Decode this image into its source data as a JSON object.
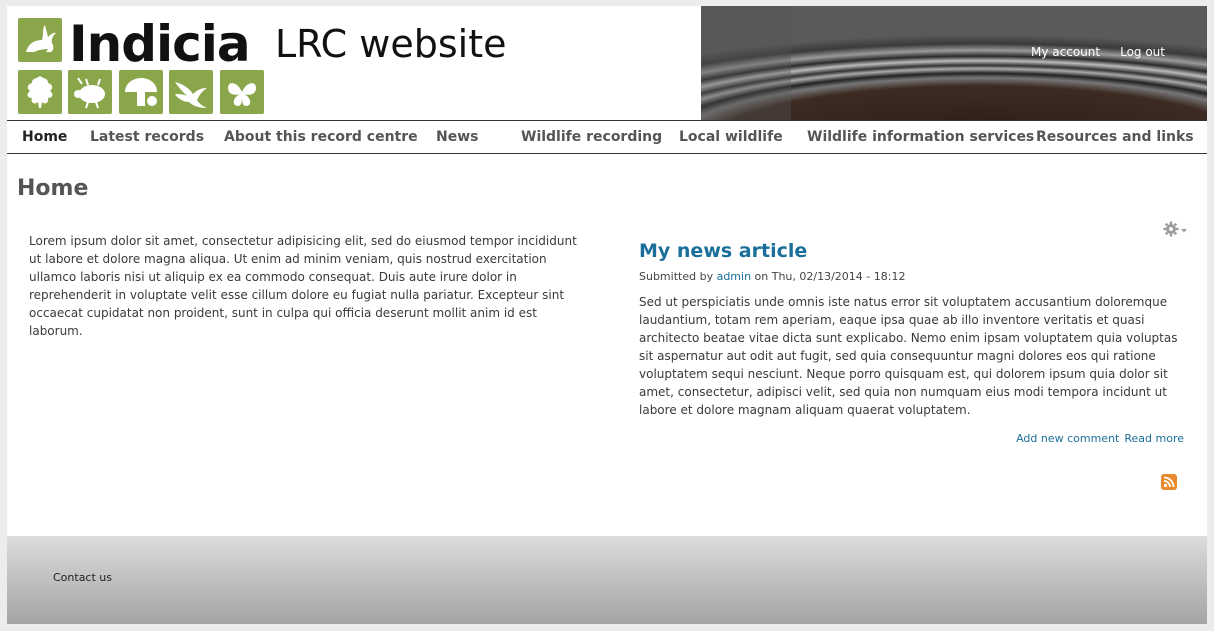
{
  "header": {
    "brand": "Indicia",
    "site_subtitle": "LRC website",
    "user_links": [
      "My account",
      "Log out"
    ]
  },
  "nav": {
    "items": [
      "Home",
      "Latest records",
      "About this record centre",
      "News",
      "Wildlife recording",
      "Local wildlife",
      "Wildlife information services",
      "Resources and links"
    ],
    "active": "Home"
  },
  "page": {
    "title": "Home",
    "intro": "Lorem ipsum dolor sit amet, consectetur adipisicing elit, sed do eiusmod tempor incididunt ut labore et dolore magna aliqua. Ut enim ad minim veniam, quis nostrud exercitation ullamco laboris nisi ut aliquip ex ea commodo consequat. Duis aute irure dolor in reprehenderit in voluptate velit esse cillum dolore eu fugiat nulla pariatur. Excepteur sint occaecat cupidatat non proident, sunt in culpa qui officia deserunt mollit anim id est laborum."
  },
  "article": {
    "title": "My news article",
    "submitted_prefix": "Submitted by",
    "author": "admin",
    "submitted_suffix": "on Thu, 02/13/2014 - 18:12",
    "body": "Sed ut perspiciatis unde omnis iste natus error sit voluptatem accusantium doloremque laudantium, totam rem aperiam, eaque ipsa quae ab illo inventore veritatis et quasi architecto beatae vitae dicta sunt explicabo. Nemo enim ipsam voluptatem quia voluptas sit aspernatur aut odit aut fugit, sed quia consequuntur magni dolores eos qui ratione voluptatem sequi nesciunt. Neque porro quisquam est, qui dolorem ipsum quia dolor sit amet, consectetur, adipisci velit, sed quia non numquam eius modi tempora incidunt ut labore et dolore magnam aliquam quaerat voluptatem.",
    "links": [
      "Add new comment",
      "Read more"
    ]
  },
  "footer": {
    "contact_label": "Contact us"
  },
  "icons": {
    "logo_tiles": [
      "hare-icon",
      "oak-leaf-icon",
      "beetle-icon",
      "mushroom-icon",
      "swallow-icon",
      "butterfly-icon"
    ],
    "gear": "gear-icon",
    "rss": "rss-icon"
  },
  "colors": {
    "brand_green": "#8aa64a",
    "link_blue": "#1a6f9a",
    "rss_orange": "#e98a2e"
  }
}
